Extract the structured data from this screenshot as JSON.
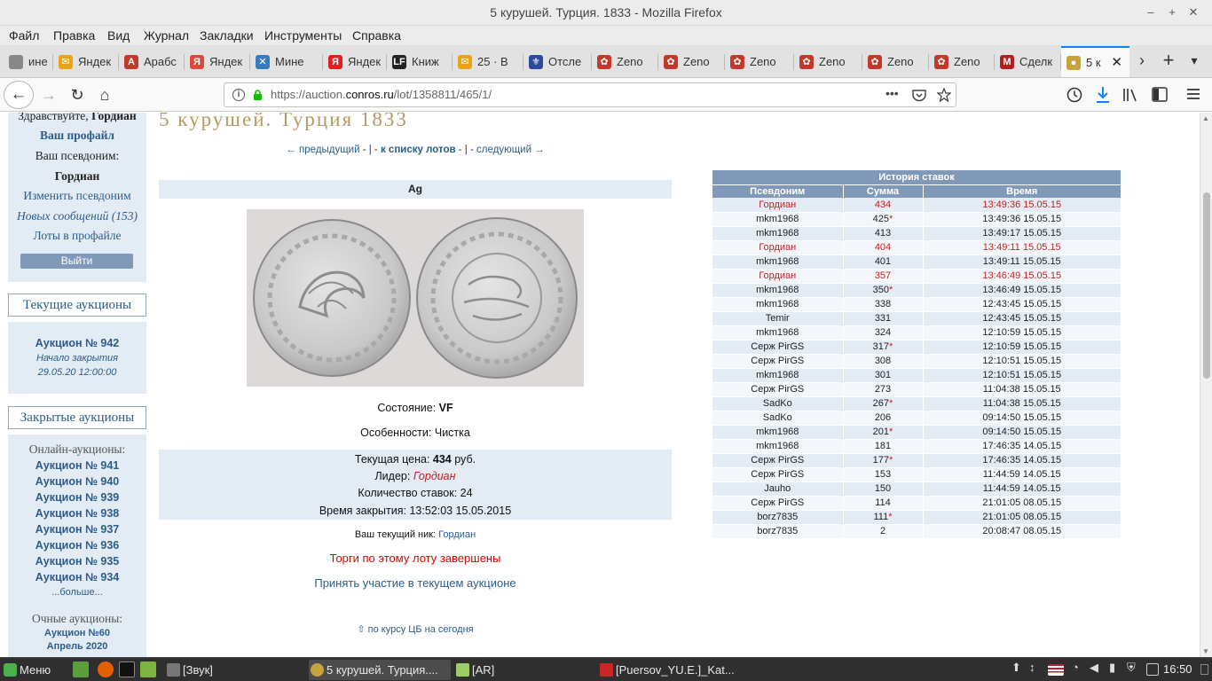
{
  "window": {
    "title": "5 курушей. Турция. 1833 - Mozilla Firefox",
    "min": "–",
    "max": "+",
    "close": "✕"
  },
  "menu": [
    "Файл",
    "Правка",
    "Вид",
    "Журнал",
    "Закладки",
    "Инструменты",
    "Справка"
  ],
  "tabs": [
    {
      "label": "ине",
      "color": "#888"
    },
    {
      "label": "Яндек",
      "color": "#e8a317"
    },
    {
      "label": "Арабс",
      "color": "#c0392b"
    },
    {
      "label": "Яндек",
      "color": "#d94a3a"
    },
    {
      "label": "Мине",
      "color": "#3a7bbf"
    },
    {
      "label": "Яндек",
      "color": "#e02020"
    },
    {
      "label": "Книж",
      "color": "#222"
    },
    {
      "label": "25 · В",
      "color": "#e8a317"
    },
    {
      "label": "Отсле",
      "color": "#2c4a9c"
    },
    {
      "label": "Zeno",
      "color": "#c0392b"
    },
    {
      "label": "Zeno",
      "color": "#c0392b"
    },
    {
      "label": "Zeno",
      "color": "#c0392b"
    },
    {
      "label": "Zeno",
      "color": "#c0392b"
    },
    {
      "label": "Zeno",
      "color": "#c0392b"
    },
    {
      "label": "Zeno",
      "color": "#c0392b"
    },
    {
      "label": "Сделк",
      "color": "#b02020"
    },
    {
      "label": "5 к",
      "color": "#c8a23c"
    }
  ],
  "tab_fav_text": [
    "",
    "✉",
    "А",
    "Я",
    "✕",
    "Я",
    "LF",
    "✉",
    "⚜",
    "✿",
    "✿",
    "✿",
    "✿",
    "✿",
    "✿",
    "М",
    "●"
  ],
  "nav": {
    "url_prefix": "https://auction.",
    "url_domain": "conros.ru",
    "url_path": "/lot/1358811/465/1/",
    "more": "•••"
  },
  "sidebar": {
    "greeting_prefix": "Здравствуйте,",
    "greeting_name": "Гордиан",
    "profile": "Ваш профайл",
    "nick_label": "Ваш псевдоним:",
    "nick": "Гордиан",
    "change_nick": "Изменить псевдоним",
    "messages": "Новых сообщений (153)",
    "lots": "Лоты в профайле",
    "logout": "Выйти",
    "current_header": "Текущие аукционы",
    "current_auction": "Аукцион № 942",
    "closing_label": "Начало закрытия",
    "closing_time": "29.05.20 12:00:00",
    "closed_header": "Закрытые аукционы",
    "online_label": "Онлайн-аукционы:",
    "closed_auctions": [
      "Аукцион № 941",
      "Аукцион № 940",
      "Аукцион № 939",
      "Аукцион № 938",
      "Аукцион № 937",
      "Аукцион № 936",
      "Аукцион № 935",
      "Аукцион № 934"
    ],
    "more": "...больше...",
    "offline_label": "Очные аукционы:",
    "offline_auction": "Аукцион №60",
    "offline_date": "Апрель 2020"
  },
  "lot": {
    "title": "5 курушей. Турция 1833",
    "prev": "предыдущий",
    "to_list": "к списку лотов",
    "next": "следующий",
    "sep": "- | -",
    "metal": "Ag",
    "condition_label": "Состояние:",
    "condition": "VF",
    "features_label": "Особенности:",
    "features": "Чистка",
    "price_label": "Текущая цена:",
    "price": "434",
    "price_unit": "руб.",
    "leader_label": "Лидер:",
    "leader": "Гордиан",
    "bids_label": "Количество ставок:",
    "bids": "24",
    "close_label": "Время закрытия:",
    "close_time": "13:52:03 15.05.2015",
    "nick_label": "Ваш текущий ник:",
    "nick": "Гордиан",
    "finished": "Торги по этому лоту завершены",
    "join": "Принять участие в текущем аукционе",
    "rate": "⇧ по курсу ЦБ на сегодня"
  },
  "history": {
    "caption": "История ставок",
    "headers": [
      "Псевдоним",
      "Сумма",
      "Время"
    ],
    "rows": [
      {
        "nick": "Гордиан",
        "sum": "434",
        "star": "",
        "time": "13:49:36 15.05.15",
        "leader": true
      },
      {
        "nick": "mkm1968",
        "sum": "425",
        "star": "*",
        "time": "13:49:36 15.05.15",
        "leader": false
      },
      {
        "nick": "mkm1968",
        "sum": "413",
        "star": "",
        "time": "13:49:17 15.05.15",
        "leader": false
      },
      {
        "nick": "Гордиан",
        "sum": "404",
        "star": "",
        "time": "13:49:11 15.05.15",
        "leader": true
      },
      {
        "nick": "mkm1968",
        "sum": "401",
        "star": "",
        "time": "13:49:11 15.05.15",
        "leader": false
      },
      {
        "nick": "Гордиан",
        "sum": "357",
        "star": "",
        "time": "13:46:49 15.05.15",
        "leader": true
      },
      {
        "nick": "mkm1968",
        "sum": "350",
        "star": "*",
        "time": "13:46:49 15.05.15",
        "leader": false
      },
      {
        "nick": "mkm1968",
        "sum": "338",
        "star": "",
        "time": "12:43:45 15.05.15",
        "leader": false
      },
      {
        "nick": "Temir",
        "sum": "331",
        "star": "",
        "time": "12:43:45 15.05.15",
        "leader": false
      },
      {
        "nick": "mkm1968",
        "sum": "324",
        "star": "",
        "time": "12:10:59 15.05.15",
        "leader": false
      },
      {
        "nick": "Серж PirGS",
        "sum": "317",
        "star": "*",
        "time": "12:10:59 15.05.15",
        "leader": false
      },
      {
        "nick": "Серж PirGS",
        "sum": "308",
        "star": "",
        "time": "12:10:51 15.05.15",
        "leader": false
      },
      {
        "nick": "mkm1968",
        "sum": "301",
        "star": "",
        "time": "12:10:51 15.05.15",
        "leader": false
      },
      {
        "nick": "Серж PirGS",
        "sum": "273",
        "star": "",
        "time": "11:04:38 15.05.15",
        "leader": false
      },
      {
        "nick": "SadKo",
        "sum": "267",
        "star": "*",
        "time": "11:04:38 15.05.15",
        "leader": false
      },
      {
        "nick": "SadKo",
        "sum": "206",
        "star": "",
        "time": "09:14:50 15.05.15",
        "leader": false
      },
      {
        "nick": "mkm1968",
        "sum": "201",
        "star": "*",
        "time": "09:14:50 15.05.15",
        "leader": false
      },
      {
        "nick": "mkm1968",
        "sum": "181",
        "star": "",
        "time": "17:46:35 14.05.15",
        "leader": false
      },
      {
        "nick": "Серж PirGS",
        "sum": "177",
        "star": "*",
        "time": "17:46:35 14.05.15",
        "leader": false
      },
      {
        "nick": "Серж PirGS",
        "sum": "153",
        "star": "",
        "time": "11:44:59 14.05.15",
        "leader": false
      },
      {
        "nick": "Jauho",
        "sum": "150",
        "star": "",
        "time": "11:44:59 14.05.15",
        "leader": false
      },
      {
        "nick": "Серж PirGS",
        "sum": "114",
        "star": "",
        "time": "21:01:05 08.05.15",
        "leader": false
      },
      {
        "nick": "borz7835",
        "sum": "111",
        "star": "*",
        "time": "21:01:05 08.05.15",
        "leader": false
      },
      {
        "nick": "borz7835",
        "sum": "2",
        "star": "",
        "time": "20:08:47 08.05.15",
        "leader": false
      }
    ]
  },
  "taskbar": {
    "menu": "Меню",
    "items": [
      "[Звук]",
      "5 курушей. Турция....",
      "[AR]",
      "[Puersov_YU.E.]_Kat..."
    ],
    "clock": "16:50"
  },
  "colors": {
    "accent": "#2b5d8c",
    "title_gold": "#b49a63",
    "leader_red": "#c81e1e",
    "panel": "#e3ebf4",
    "header_blue": "#8099b8"
  }
}
